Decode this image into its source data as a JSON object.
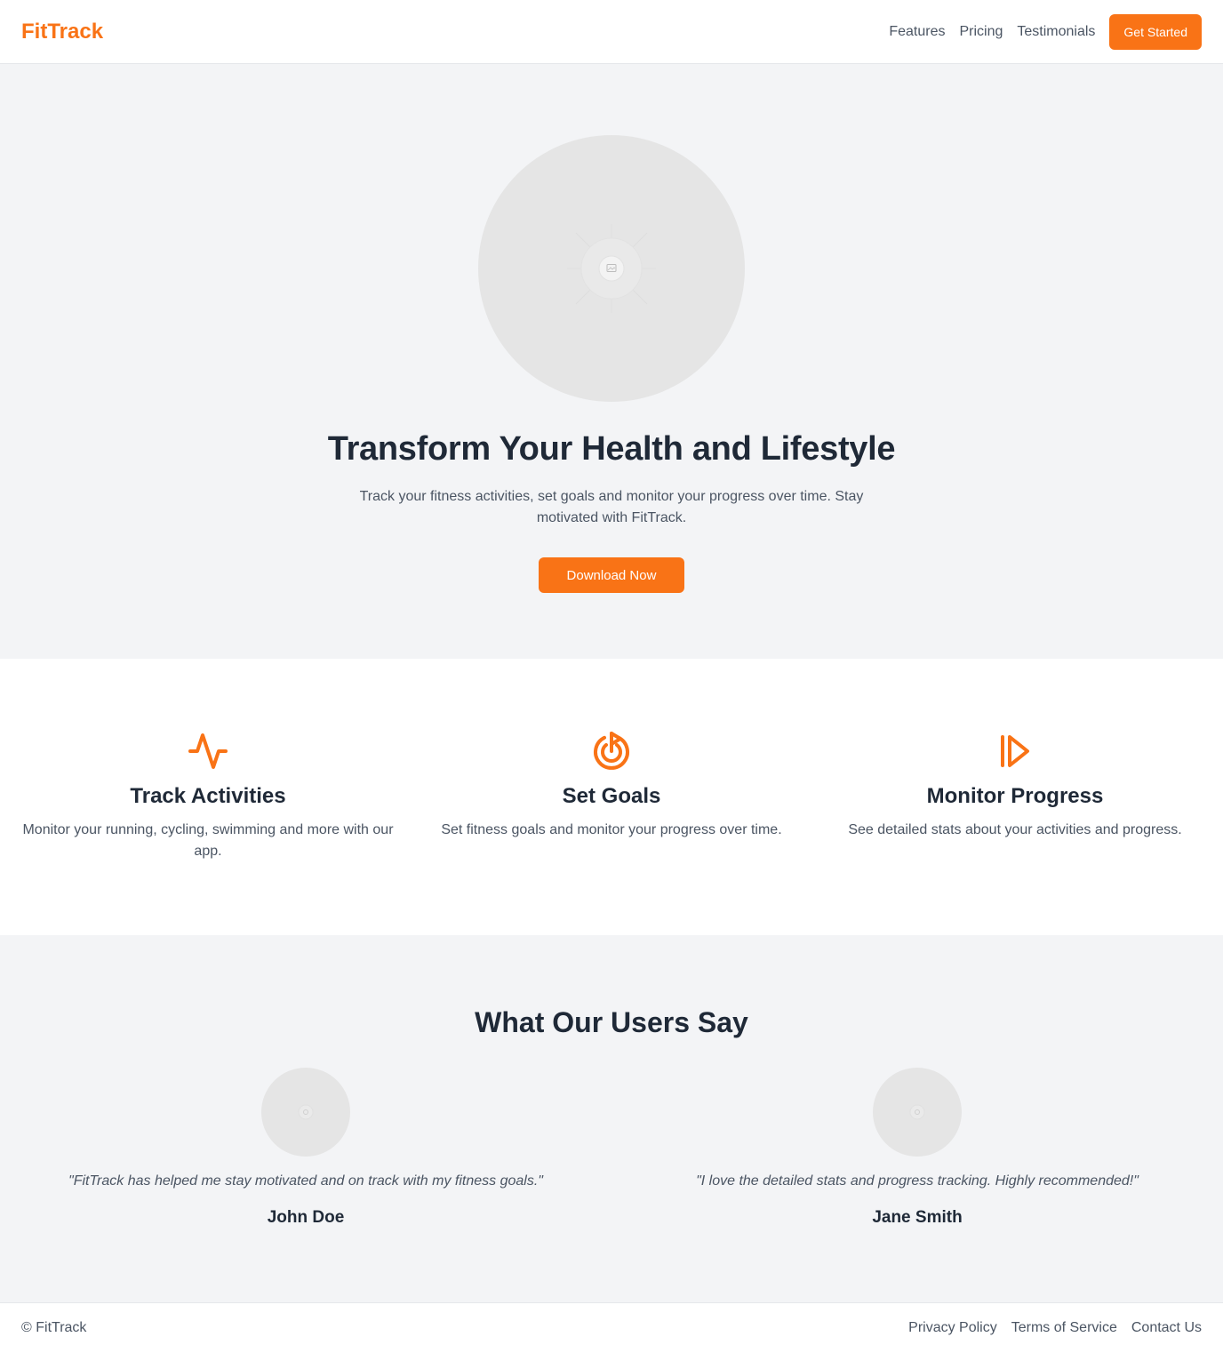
{
  "colors": {
    "accent": "#f97316",
    "heading": "#1f2937",
    "body_text": "#4b5563",
    "section_bg": "#f3f4f6",
    "placeholder_bg": "#e5e5e5"
  },
  "header": {
    "logo": "FitTrack",
    "nav": [
      {
        "label": "Features"
      },
      {
        "label": "Pricing"
      },
      {
        "label": "Testimonials"
      }
    ],
    "cta_label": "Get Started"
  },
  "hero": {
    "image_icon": "image-placeholder-icon",
    "title": "Transform Your Health and Lifestyle",
    "subtitle": "Track your fitness activities, set goals and monitor your progress over time. Stay motivated with FitTrack.",
    "cta_label": "Download Now"
  },
  "features": [
    {
      "icon": "activity-pulse-icon",
      "title": "Track Activities",
      "description": "Monitor your running, cycling, swimming and more with our app."
    },
    {
      "icon": "target-goal-icon",
      "title": "Set Goals",
      "description": "Set fitness goals and monitor your progress over time."
    },
    {
      "icon": "skip-forward-icon",
      "title": "Monitor Progress",
      "description": "See detailed stats about your activities and progress."
    }
  ],
  "testimonials": {
    "title": "What Our Users Say",
    "items": [
      {
        "quote": "\"FitTrack has helped me stay motivated and on track with my fitness goals.\"",
        "author": "John Doe"
      },
      {
        "quote": "\"I love the detailed stats and progress tracking. Highly recommended!\"",
        "author": "Jane Smith"
      }
    ]
  },
  "footer": {
    "copyright": "© FitTrack",
    "links": [
      {
        "label": "Privacy Policy"
      },
      {
        "label": "Terms of Service"
      },
      {
        "label": "Contact Us"
      }
    ]
  }
}
